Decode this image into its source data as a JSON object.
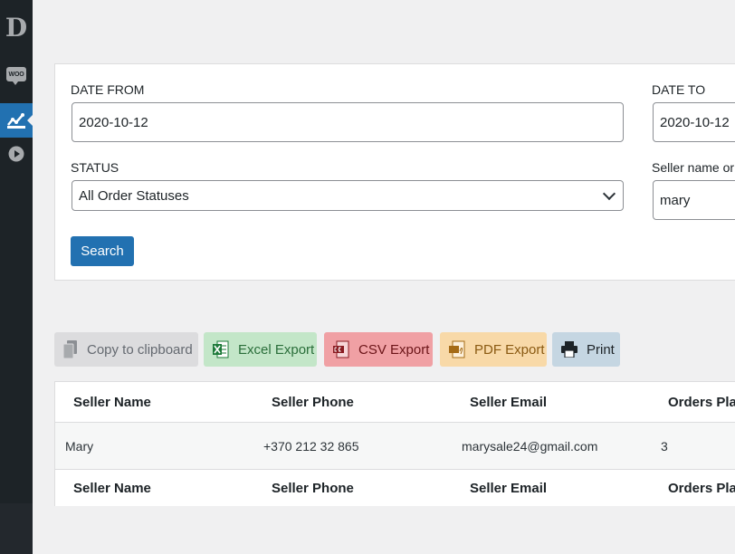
{
  "sidebar": {
    "logo_letter": "D",
    "woo_label": "WOO"
  },
  "filters": {
    "date_from_label": "DATE FROM",
    "date_from_value": "2020-10-12",
    "date_to_label": "DATE TO",
    "date_to_value": "2020-10-12",
    "status_label": "STATUS",
    "status_value": "All Order Statuses",
    "seller_label": "Seller name or",
    "seller_value": "mary",
    "search_button": "Search"
  },
  "export_buttons": [
    {
      "label": "Copy to clipboard",
      "icon": "copy-icon",
      "bg": "#dcdcde",
      "color": "#646970"
    },
    {
      "label": "Excel Export",
      "icon": "excel-icon",
      "bg": "#c3e6c8",
      "color": "#2a6e3a"
    },
    {
      "label": "CSV Export",
      "icon": "csv-icon",
      "bg": "#f0a0a4",
      "color": "#6b1418"
    },
    {
      "label": "PDF Export",
      "icon": "pdf-icon",
      "bg": "#f8d9a8",
      "color": "#8a5a12"
    },
    {
      "label": "Print",
      "icon": "print-icon",
      "bg": "#c5d6e2",
      "color": "#1d2327"
    }
  ],
  "table": {
    "columns": [
      "Seller Name",
      "Seller Phone",
      "Seller Email",
      "Orders Pla"
    ],
    "rows": [
      [
        "Mary",
        "+370 212 32 865",
        "marysale24@gmail.com",
        "3"
      ]
    ],
    "footer_columns": [
      "Seller Name",
      "Seller Phone",
      "Seller Email",
      "Orders Pla"
    ]
  },
  "colors": {
    "sidebar_bg": "#1d2327",
    "accent": "#2271b1",
    "page_bg": "#f0f0f1"
  }
}
